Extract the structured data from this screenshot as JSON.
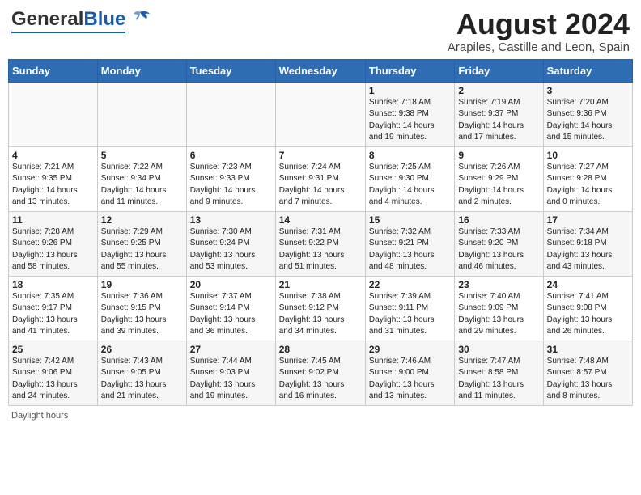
{
  "header": {
    "logo_general": "General",
    "logo_blue": "Blue",
    "month_year": "August 2024",
    "location": "Arapiles, Castille and Leon, Spain"
  },
  "footer": {
    "daylight_label": "Daylight hours"
  },
  "days_of_week": [
    "Sunday",
    "Monday",
    "Tuesday",
    "Wednesday",
    "Thursday",
    "Friday",
    "Saturday"
  ],
  "weeks": [
    [
      {
        "day": "",
        "info": ""
      },
      {
        "day": "",
        "info": ""
      },
      {
        "day": "",
        "info": ""
      },
      {
        "day": "",
        "info": ""
      },
      {
        "day": "1",
        "info": "Sunrise: 7:18 AM\nSunset: 9:38 PM\nDaylight: 14 hours\nand 19 minutes."
      },
      {
        "day": "2",
        "info": "Sunrise: 7:19 AM\nSunset: 9:37 PM\nDaylight: 14 hours\nand 17 minutes."
      },
      {
        "day": "3",
        "info": "Sunrise: 7:20 AM\nSunset: 9:36 PM\nDaylight: 14 hours\nand 15 minutes."
      }
    ],
    [
      {
        "day": "4",
        "info": "Sunrise: 7:21 AM\nSunset: 9:35 PM\nDaylight: 14 hours\nand 13 minutes."
      },
      {
        "day": "5",
        "info": "Sunrise: 7:22 AM\nSunset: 9:34 PM\nDaylight: 14 hours\nand 11 minutes."
      },
      {
        "day": "6",
        "info": "Sunrise: 7:23 AM\nSunset: 9:33 PM\nDaylight: 14 hours\nand 9 minutes."
      },
      {
        "day": "7",
        "info": "Sunrise: 7:24 AM\nSunset: 9:31 PM\nDaylight: 14 hours\nand 7 minutes."
      },
      {
        "day": "8",
        "info": "Sunrise: 7:25 AM\nSunset: 9:30 PM\nDaylight: 14 hours\nand 4 minutes."
      },
      {
        "day": "9",
        "info": "Sunrise: 7:26 AM\nSunset: 9:29 PM\nDaylight: 14 hours\nand 2 minutes."
      },
      {
        "day": "10",
        "info": "Sunrise: 7:27 AM\nSunset: 9:28 PM\nDaylight: 14 hours\nand 0 minutes."
      }
    ],
    [
      {
        "day": "11",
        "info": "Sunrise: 7:28 AM\nSunset: 9:26 PM\nDaylight: 13 hours\nand 58 minutes."
      },
      {
        "day": "12",
        "info": "Sunrise: 7:29 AM\nSunset: 9:25 PM\nDaylight: 13 hours\nand 55 minutes."
      },
      {
        "day": "13",
        "info": "Sunrise: 7:30 AM\nSunset: 9:24 PM\nDaylight: 13 hours\nand 53 minutes."
      },
      {
        "day": "14",
        "info": "Sunrise: 7:31 AM\nSunset: 9:22 PM\nDaylight: 13 hours\nand 51 minutes."
      },
      {
        "day": "15",
        "info": "Sunrise: 7:32 AM\nSunset: 9:21 PM\nDaylight: 13 hours\nand 48 minutes."
      },
      {
        "day": "16",
        "info": "Sunrise: 7:33 AM\nSunset: 9:20 PM\nDaylight: 13 hours\nand 46 minutes."
      },
      {
        "day": "17",
        "info": "Sunrise: 7:34 AM\nSunset: 9:18 PM\nDaylight: 13 hours\nand 43 minutes."
      }
    ],
    [
      {
        "day": "18",
        "info": "Sunrise: 7:35 AM\nSunset: 9:17 PM\nDaylight: 13 hours\nand 41 minutes."
      },
      {
        "day": "19",
        "info": "Sunrise: 7:36 AM\nSunset: 9:15 PM\nDaylight: 13 hours\nand 39 minutes."
      },
      {
        "day": "20",
        "info": "Sunrise: 7:37 AM\nSunset: 9:14 PM\nDaylight: 13 hours\nand 36 minutes."
      },
      {
        "day": "21",
        "info": "Sunrise: 7:38 AM\nSunset: 9:12 PM\nDaylight: 13 hours\nand 34 minutes."
      },
      {
        "day": "22",
        "info": "Sunrise: 7:39 AM\nSunset: 9:11 PM\nDaylight: 13 hours\nand 31 minutes."
      },
      {
        "day": "23",
        "info": "Sunrise: 7:40 AM\nSunset: 9:09 PM\nDaylight: 13 hours\nand 29 minutes."
      },
      {
        "day": "24",
        "info": "Sunrise: 7:41 AM\nSunset: 9:08 PM\nDaylight: 13 hours\nand 26 minutes."
      }
    ],
    [
      {
        "day": "25",
        "info": "Sunrise: 7:42 AM\nSunset: 9:06 PM\nDaylight: 13 hours\nand 24 minutes."
      },
      {
        "day": "26",
        "info": "Sunrise: 7:43 AM\nSunset: 9:05 PM\nDaylight: 13 hours\nand 21 minutes."
      },
      {
        "day": "27",
        "info": "Sunrise: 7:44 AM\nSunset: 9:03 PM\nDaylight: 13 hours\nand 19 minutes."
      },
      {
        "day": "28",
        "info": "Sunrise: 7:45 AM\nSunset: 9:02 PM\nDaylight: 13 hours\nand 16 minutes."
      },
      {
        "day": "29",
        "info": "Sunrise: 7:46 AM\nSunset: 9:00 PM\nDaylight: 13 hours\nand 13 minutes."
      },
      {
        "day": "30",
        "info": "Sunrise: 7:47 AM\nSunset: 8:58 PM\nDaylight: 13 hours\nand 11 minutes."
      },
      {
        "day": "31",
        "info": "Sunrise: 7:48 AM\nSunset: 8:57 PM\nDaylight: 13 hours\nand 8 minutes."
      }
    ]
  ]
}
